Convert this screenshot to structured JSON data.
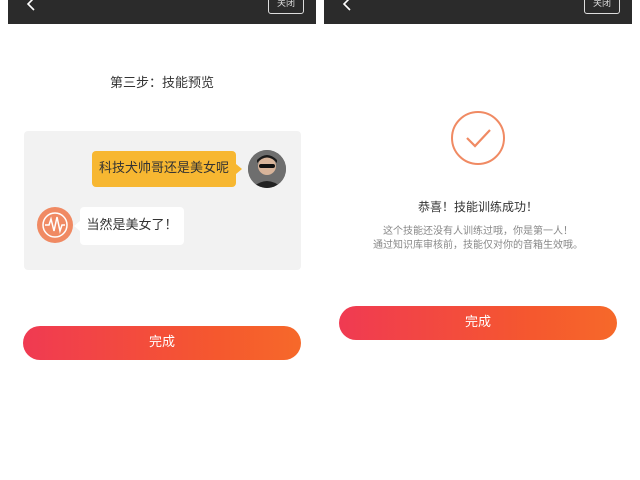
{
  "left": {
    "top_action": "关闭",
    "step_title": "第三步：技能预览",
    "user_message": "科技犬帅哥还是美女呢",
    "bot_message": "当然是美女了！",
    "done_button": "完成"
  },
  "right": {
    "top_action": "关闭",
    "success_title": "恭喜！技能训练成功！",
    "success_line1": "这个技能还没有人训练过哦，你是第一人！",
    "success_line2": "通过知识库审核前，技能仅对你的音箱生效哦。",
    "done_button": "完成"
  },
  "colors": {
    "accent_start": "#f03a52",
    "accent_end": "#f6692a",
    "user_bubble": "#f7b731",
    "check_icon": "#f08a63"
  },
  "icons": [
    "back-arrow-icon",
    "user-avatar",
    "bot-waveform-icon",
    "success-check-icon"
  ]
}
